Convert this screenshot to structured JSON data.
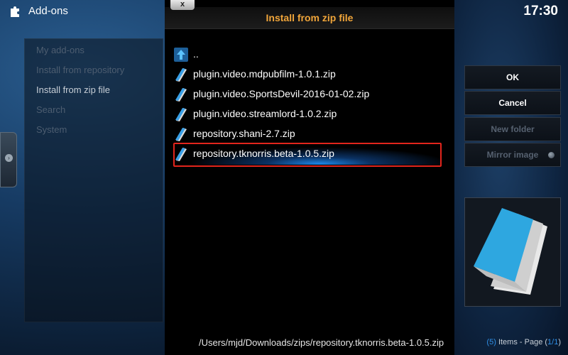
{
  "header": {
    "section_title": "Add-ons",
    "clock": "17:30",
    "section_icon": "puzzle-icon"
  },
  "left_menu": {
    "items": [
      {
        "label": "My add-ons",
        "active": false
      },
      {
        "label": "Install from repository",
        "active": false
      },
      {
        "label": "Install from zip file",
        "active": true
      },
      {
        "label": "Search",
        "active": false
      },
      {
        "label": "System",
        "active": false
      }
    ]
  },
  "dialog": {
    "title": "Install from zip file",
    "close_label": "x",
    "files": [
      {
        "name": "..",
        "icon": "folder-up-icon"
      },
      {
        "name": "plugin.video.mdpubfilm-1.0.1.zip",
        "icon": "zip-file-icon"
      },
      {
        "name": "plugin.video.SportsDevil-2016-01-02.zip",
        "icon": "zip-file-icon"
      },
      {
        "name": "plugin.video.streamlord-1.0.2.zip",
        "icon": "zip-file-icon"
      },
      {
        "name": "repository.shani-2.7.zip",
        "icon": "zip-file-icon"
      },
      {
        "name": "repository.tknorris.beta-1.0.5.zip",
        "icon": "zip-file-icon",
        "selected": true
      }
    ],
    "current_path": "/Users/mjd/Downloads/zips/repository.tknorris.beta-1.0.5.zip"
  },
  "buttons": {
    "ok": "OK",
    "cancel": "Cancel",
    "new_folder": "New folder",
    "mirror_image": "Mirror image"
  },
  "footer": {
    "count_open": "(",
    "count": "5",
    "count_close": ")",
    "items_text": " Items - Page (",
    "page": "1/1",
    "page_close": ")"
  },
  "colors": {
    "title_accent": "#f0a53a",
    "selection_glow": "#1e8cf0",
    "highlight_border": "#e2251c",
    "count_accent": "#2f8fe6"
  }
}
